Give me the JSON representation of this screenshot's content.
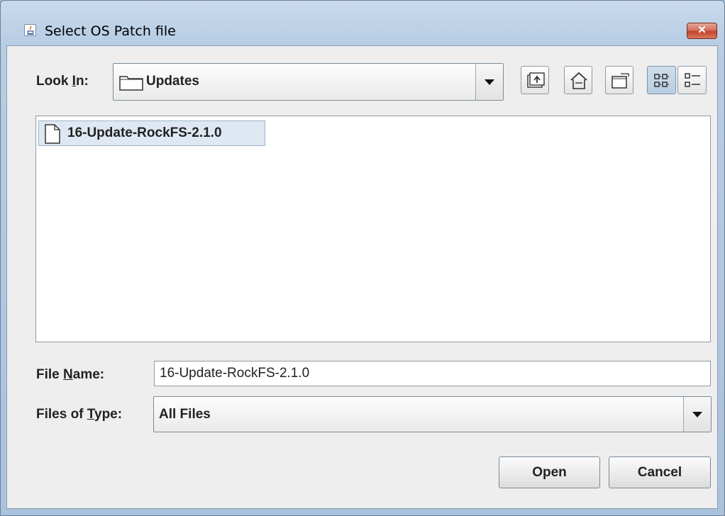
{
  "window": {
    "title": "Select OS Patch file",
    "close_glyph": "✕",
    "app_icon": "java-icon"
  },
  "look_in": {
    "label_pre": "Look ",
    "label_mnemonic": "I",
    "label_post": "n:",
    "selected": "Updates",
    "icon": "folder-icon"
  },
  "toolbar": {
    "buttons": [
      {
        "name": "up-one-level",
        "icon": "up-folder-icon"
      },
      {
        "name": "home",
        "icon": "home-icon"
      },
      {
        "name": "new-folder",
        "icon": "new-folder-icon"
      },
      {
        "name": "list-view",
        "icon": "list-view-icon",
        "selected": true
      },
      {
        "name": "details-view",
        "icon": "details-view-icon",
        "selected": false
      }
    ]
  },
  "files": [
    {
      "name": "16-Update-RockFS-2.1.0",
      "icon": "file-icon",
      "selected": true
    }
  ],
  "file_name": {
    "label_pre": "File ",
    "label_mnemonic": "N",
    "label_post": "ame:",
    "value": "16-Update-RockFS-2.1.0"
  },
  "file_type": {
    "label_pre": "Files of ",
    "label_mnemonic": "T",
    "label_post": "ype:",
    "selected": "All Files"
  },
  "actions": {
    "open_label": "Open",
    "cancel_label": "Cancel"
  },
  "colors": {
    "frame": "#b7cde4",
    "client_bg": "#eeeeee",
    "selection": "#dfe8f2",
    "close_button": "#c2432b"
  }
}
